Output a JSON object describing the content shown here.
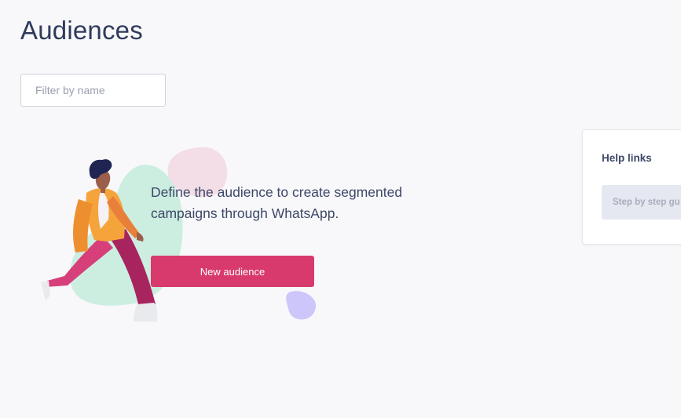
{
  "header": {
    "title": "Audiences"
  },
  "filter": {
    "placeholder": "Filter by name",
    "value": ""
  },
  "empty_state": {
    "message": "Define the audience to create segmented campaigns through WhatsApp.",
    "button_label": "New audience"
  },
  "help_card": {
    "title": "Help links",
    "links": [
      {
        "label": "Step by step gu"
      }
    ]
  },
  "colors": {
    "primary_button": "#d83a6e",
    "title_text": "#2f3a5c",
    "background": "#f8f8fa"
  }
}
